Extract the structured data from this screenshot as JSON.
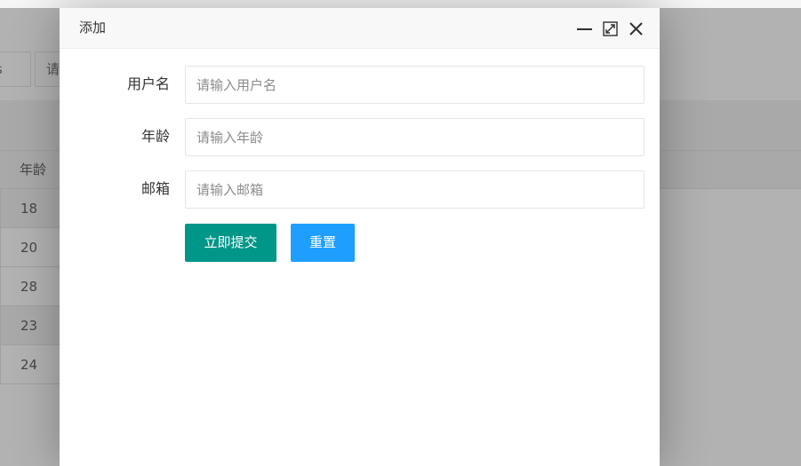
{
  "background": {
    "toolbar_inputs": [
      {
        "text": "s"
      },
      {
        "text": "请"
      }
    ],
    "table": {
      "header": "年龄",
      "rows": [
        "18",
        "20",
        "28",
        "23",
        "24"
      ]
    }
  },
  "dialog": {
    "title": "添加",
    "tools": {
      "minimize_icon": "minus-icon",
      "maximize_icon": "maximize-icon",
      "close_icon": "close-icon"
    },
    "form": {
      "fields": [
        {
          "label": "用户名",
          "placeholder": "请输入用户名",
          "value": ""
        },
        {
          "label": "年龄",
          "placeholder": "请输入年龄",
          "value": ""
        },
        {
          "label": "邮箱",
          "placeholder": "请输入邮箱",
          "value": ""
        }
      ],
      "submit_label": "立即提交",
      "reset_label": "重置"
    }
  },
  "colors": {
    "submit": "#009688",
    "reset": "#1e9fff",
    "overlay": "rgba(0,0,0,0.3)"
  }
}
